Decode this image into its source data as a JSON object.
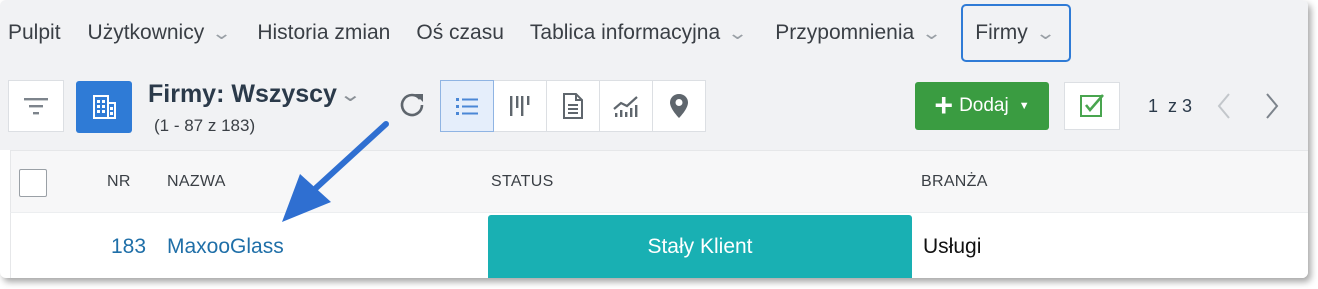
{
  "nav": {
    "items": [
      {
        "label": "Pulpit",
        "has_dropdown": false
      },
      {
        "label": "Użytkownicy",
        "has_dropdown": true
      },
      {
        "label": "Historia zmian",
        "has_dropdown": false
      },
      {
        "label": "Oś czasu",
        "has_dropdown": false
      },
      {
        "label": "Tablica informacyjna",
        "has_dropdown": true
      },
      {
        "label": "Przypomnienia",
        "has_dropdown": true
      },
      {
        "label": "Firmy",
        "has_dropdown": true,
        "active": true
      }
    ]
  },
  "toolbar": {
    "view_title": "Firmy: Wszyscy",
    "view_count": "(1 - 87 z 183)",
    "add_label": "Dodaj",
    "pager_text": "1  z 3",
    "icons": [
      "filter-icon",
      "building-icon",
      "refresh-icon",
      "list-view-icon",
      "kanban-view-icon",
      "document-view-icon",
      "chart-view-icon",
      "map-pin-icon",
      "checkbox-icon"
    ]
  },
  "table": {
    "columns": [
      "NR",
      "NAZWA",
      "STATUS",
      "BRANŻA"
    ],
    "rows": [
      {
        "nr": "183",
        "name": "MaxooGlass",
        "status": "Stały Klient",
        "branch": "Usługi"
      }
    ]
  },
  "colors": {
    "accent": "#2f7bd6",
    "add_button": "#3a9c41",
    "status_badge": "#19b0b3",
    "link": "#1f6fa8",
    "annotation_arrow": "#2f6fd1"
  }
}
